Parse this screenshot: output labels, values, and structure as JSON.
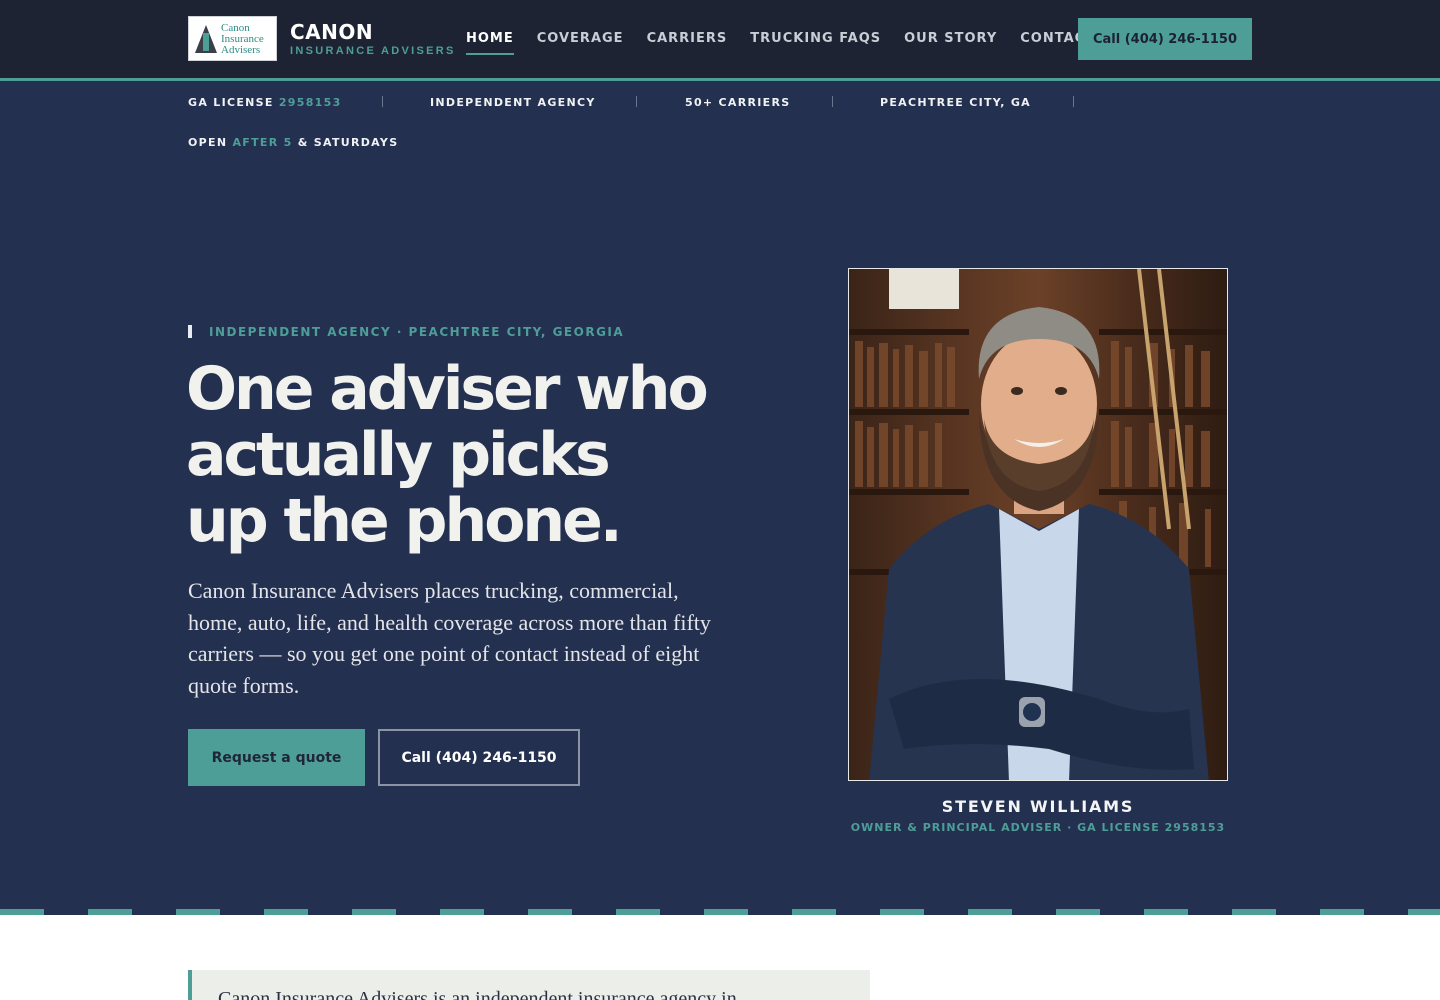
{
  "nav": {
    "logo_text": "Canon Insurance Advisers",
    "brand": "CANON",
    "brand_sub": "INSURANCE ADVISERS",
    "items": [
      {
        "label": "HOME",
        "active": true
      },
      {
        "label": "COVERAGE",
        "active": false
      },
      {
        "label": "CARRIERS",
        "active": false
      },
      {
        "label": "TRUCKING FAQS",
        "active": false
      },
      {
        "label": "OUR STORY",
        "active": false
      },
      {
        "label": "CONTACT",
        "active": false
      }
    ],
    "call_label": "Call (404) 246-1150"
  },
  "strip": {
    "license_label": "GA LICENSE",
    "license_number": "2958153",
    "independent": "INDEPENDENT AGENCY",
    "carriers": "50+ CARRIERS",
    "location": "PEACHTREE CITY, GA",
    "hours_prefix": "OPEN",
    "hours_highlight": "AFTER 5",
    "hours_suffix": "& SATURDAYS"
  },
  "hero": {
    "eyebrow": "INDEPENDENT AGENCY · PEACHTREE CITY, GEORGIA",
    "headline_1": "One adviser who",
    "headline_2": "actually picks",
    "headline_3": "up the phone.",
    "lede": "Canon Insurance Advisers places trucking, commercial, home, auto, life, and health coverage across more than fifty carriers — so you get one point of contact instead of eight quote forms.",
    "primary_button": "Request a quote",
    "secondary_button": "Call (404) 246-1150"
  },
  "person": {
    "name": "STEVEN WILLIAMS",
    "title": "OWNER & PRINCIPAL ADVISER · GA LICENSE 2958153"
  },
  "about": {
    "intro": "Canon Insurance Advisers is an independent insurance agency in"
  },
  "colors": {
    "navy": "#243050",
    "nav_dark": "#1d2333",
    "teal": "#4e9e98",
    "cream": "#f1f2ee"
  }
}
